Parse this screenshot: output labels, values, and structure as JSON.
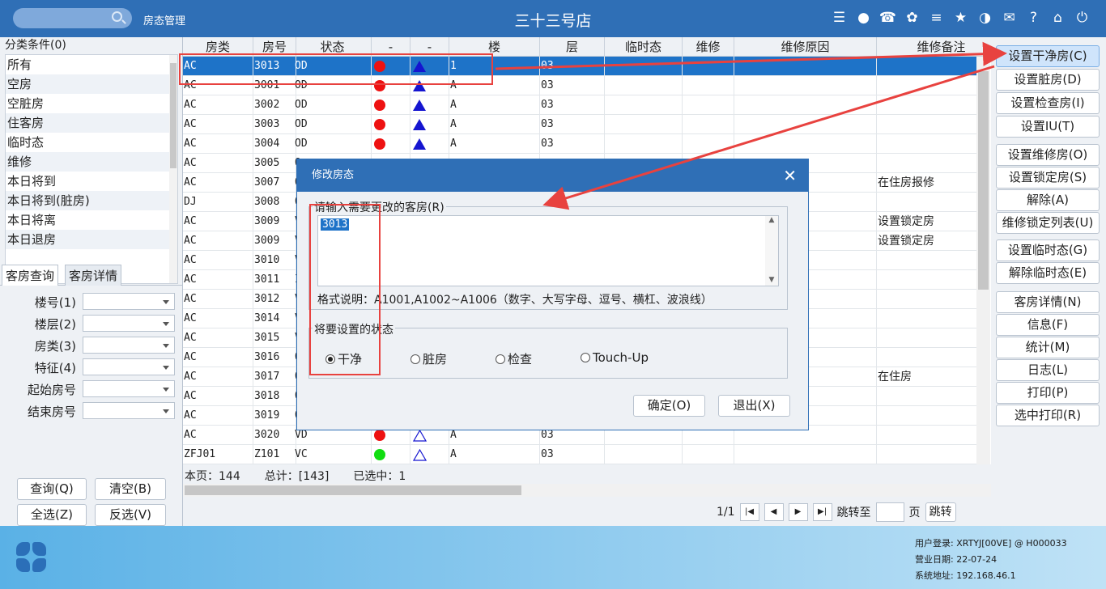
{
  "topbar": {
    "module_title": "房态管理",
    "store_title": "三十三号店",
    "icons": [
      "wifi-icon",
      "chat-icon",
      "phone-icon",
      "palette-icon",
      "menu-icon",
      "star-icon",
      "theme-icon",
      "mail-icon",
      "help-icon",
      "home-icon",
      "power-icon"
    ]
  },
  "sidebar": {
    "category_header": "分类条件(0)",
    "categories": [
      "所有",
      "空房",
      "空脏房",
      "住客房",
      "临时态",
      "维修",
      "本日将到",
      "本日将到(脏房)",
      "本日将离",
      "本日退房"
    ],
    "tabs": [
      "客房查询",
      "客房详情"
    ],
    "fields": [
      {
        "label": "楼号(1)",
        "type": "select"
      },
      {
        "label": "楼层(2)",
        "type": "select"
      },
      {
        "label": "房类(3)",
        "type": "select"
      },
      {
        "label": "特征(4)",
        "type": "select"
      },
      {
        "label": "起始房号",
        "type": "input"
      },
      {
        "label": "结束房号",
        "type": "input"
      }
    ],
    "buttons": {
      "query": "查询(Q)",
      "clear": "清空(B)",
      "select_all": "全选(Z)",
      "invert": "反选(V)"
    }
  },
  "grid": {
    "columns": [
      "房类",
      "房号",
      "状态",
      "-",
      "-",
      "楼",
      "层",
      "临时态",
      "维修",
      "维修原因",
      "维修备注"
    ],
    "rows": [
      {
        "type": "AC",
        "room": "3013",
        "status": "OD",
        "dot": "red",
        "tri": "filled",
        "building": "1",
        "floor": "03",
        "note": "",
        "selected": true
      },
      {
        "type": "AC",
        "room": "3001",
        "status": "OD",
        "dot": "red",
        "tri": "filled",
        "building": "A",
        "floor": "03",
        "note": ""
      },
      {
        "type": "AC",
        "room": "3002",
        "status": "OD",
        "dot": "red",
        "tri": "filled",
        "building": "A",
        "floor": "03",
        "note": ""
      },
      {
        "type": "AC",
        "room": "3003",
        "status": "OD",
        "dot": "red",
        "tri": "filled",
        "building": "A",
        "floor": "03",
        "note": ""
      },
      {
        "type": "AC",
        "room": "3004",
        "status": "OD",
        "dot": "red",
        "tri": "filled",
        "building": "A",
        "floor": "03",
        "note": ""
      },
      {
        "type": "AC",
        "room": "3005",
        "status": "O",
        "dot": "",
        "tri": "",
        "building": "",
        "floor": "",
        "note": ""
      },
      {
        "type": "AC",
        "room": "3007",
        "status": "O",
        "dot": "",
        "tri": "",
        "building": "",
        "floor": "",
        "note": "在住房报修"
      },
      {
        "type": "DJ",
        "room": "3008",
        "status": "O",
        "dot": "",
        "tri": "",
        "building": "",
        "floor": "",
        "note": ""
      },
      {
        "type": "AC",
        "room": "3009",
        "status": "V",
        "dot": "",
        "tri": "",
        "building": "",
        "floor": "",
        "note": "设置锁定房"
      },
      {
        "type": "AC",
        "room": "3009",
        "status": "V",
        "dot": "",
        "tri": "",
        "building": "",
        "floor": "",
        "note": "设置锁定房"
      },
      {
        "type": "AC",
        "room": "3010",
        "status": "V",
        "dot": "",
        "tri": "",
        "building": "",
        "floor": "",
        "note": ""
      },
      {
        "type": "AC",
        "room": "3011",
        "status": "I",
        "dot": "",
        "tri": "",
        "building": "",
        "floor": "",
        "note": ""
      },
      {
        "type": "AC",
        "room": "3012",
        "status": "V",
        "dot": "",
        "tri": "",
        "building": "",
        "floor": "",
        "note": ""
      },
      {
        "type": "AC",
        "room": "3014",
        "status": "V",
        "dot": "",
        "tri": "",
        "building": "",
        "floor": "",
        "note": ""
      },
      {
        "type": "AC",
        "room": "3015",
        "status": "V",
        "dot": "",
        "tri": "",
        "building": "",
        "floor": "",
        "note": ""
      },
      {
        "type": "AC",
        "room": "3016",
        "status": "O",
        "dot": "",
        "tri": "",
        "building": "",
        "floor": "",
        "note": ""
      },
      {
        "type": "AC",
        "room": "3017",
        "status": "O",
        "dot": "",
        "tri": "",
        "building": "",
        "floor": "",
        "note": "在住房"
      },
      {
        "type": "AC",
        "room": "3018",
        "status": "O",
        "dot": "",
        "tri": "",
        "building": "",
        "floor": "",
        "note": ""
      },
      {
        "type": "AC",
        "room": "3019",
        "status": "O",
        "dot": "",
        "tri": "",
        "building": "",
        "floor": "",
        "note": ""
      },
      {
        "type": "AC",
        "room": "3020",
        "status": "VD",
        "dot": "red",
        "tri": "outline",
        "building": "A",
        "floor": "03",
        "note": ""
      },
      {
        "type": "ZFJ01",
        "room": "Z101",
        "status": "VC",
        "dot": "green",
        "tri": "outline",
        "building": "A",
        "floor": "03",
        "note": ""
      }
    ],
    "footer": {
      "page_count": "本页：144",
      "total": "总计：[143]",
      "selected": "已选中：1"
    },
    "pager": {
      "page": "1/1",
      "jump_label": "跳转至",
      "page_unit": "页",
      "jump_button": "跳转"
    }
  },
  "actions": [
    "设置干净房(C)",
    "设置脏房(D)",
    "设置检查房(I)",
    "设置IU(T)",
    "设置维修房(O)",
    "设置锁定房(S)",
    "解除(A)",
    "维修锁定列表(U)",
    "设置临时态(G)",
    "解除临时态(E)",
    "客房详情(N)",
    "信息(F)",
    "统计(M)",
    "日志(L)",
    "打印(P)",
    "选中打印(R)"
  ],
  "dialog": {
    "title": "修改房态",
    "input_legend": "请输入需要更改的客房(R)",
    "input_value": "3013",
    "format_hint": "格式说明：A1001,A1002~A1006（数字、大写字母、逗号、横杠、波浪线）",
    "status_legend": "将要设置的状态",
    "options": [
      "干净",
      "脏房",
      "检查",
      "Touch-Up"
    ],
    "selected_option": "干净",
    "ok": "确定(O)",
    "cancel": "退出(X)"
  },
  "bottom": {
    "user": "用户登录:  XRTYJ[00VE] @ H000033",
    "business_date": "营业日期:  22-07-24",
    "system_address": "系统地址:  192.168.46.1"
  },
  "colors": {
    "primary": "#2f6fb6",
    "selected_row": "#1e73c8",
    "annotation": "#e8423f",
    "dot_red": "#ee1111",
    "dot_green": "#11dd11",
    "triangle": "#1515d0"
  }
}
